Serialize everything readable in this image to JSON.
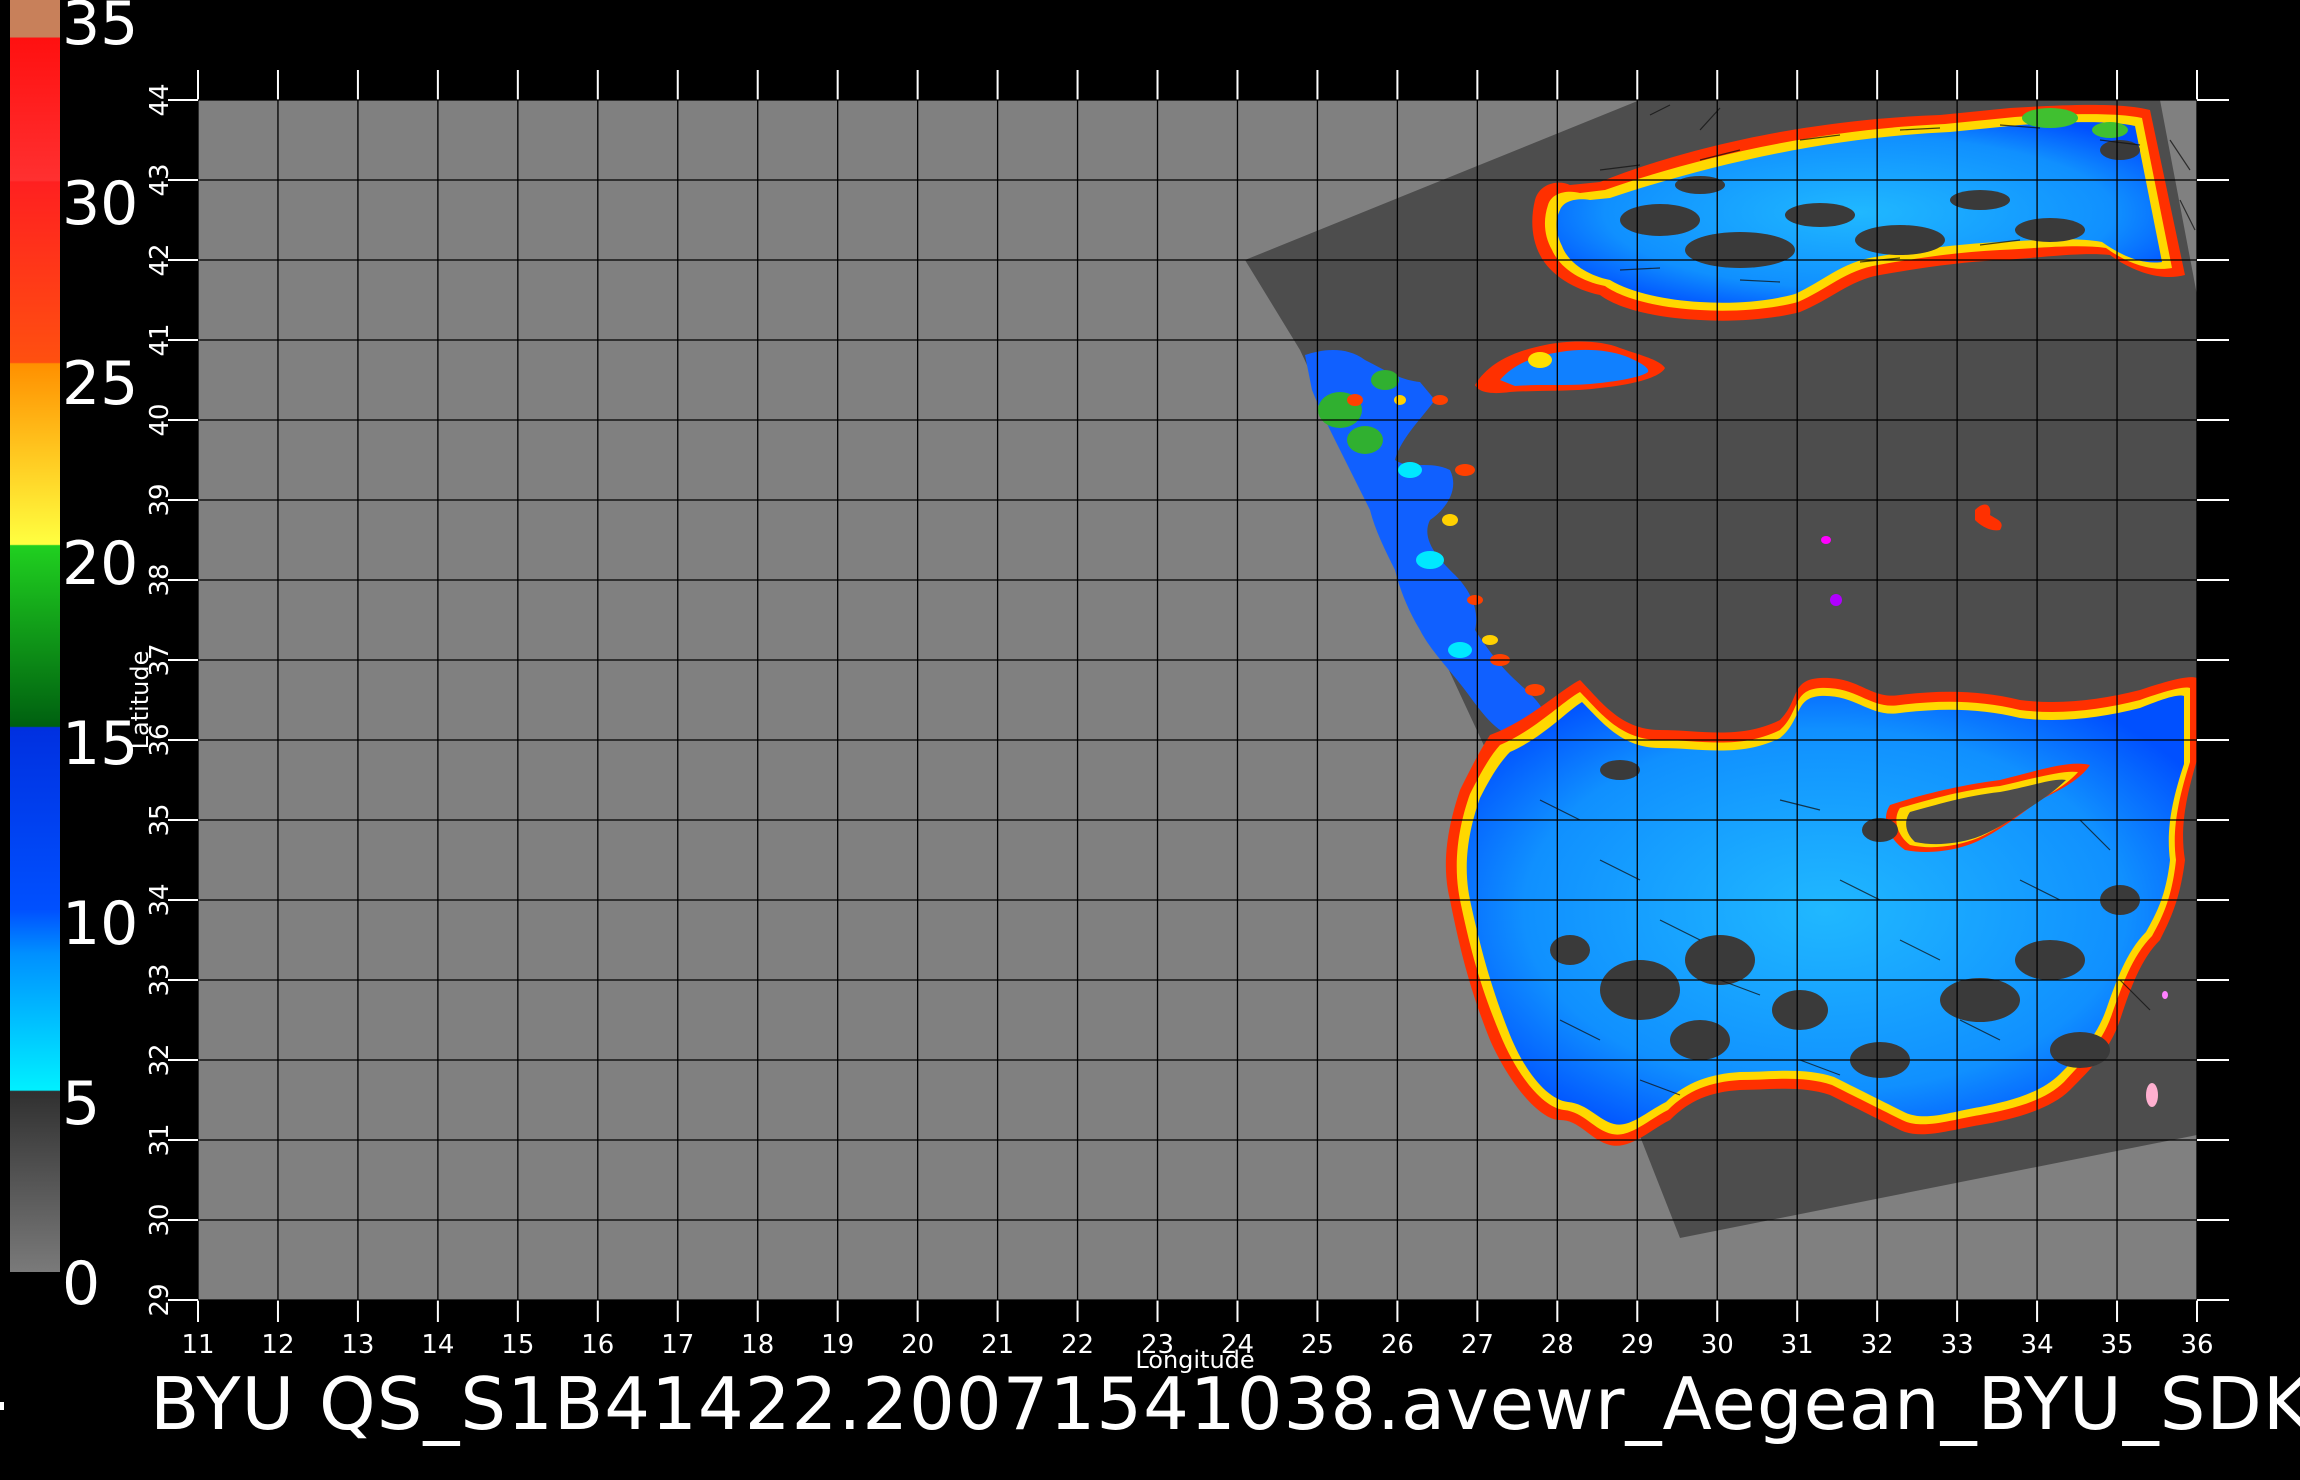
{
  "footer": {
    "title": "BYU  QS_S1B41422.20071541038.avewr_Aegean_BYU_SDK"
  },
  "map": {
    "xlabel": "Longitude",
    "ylabel": "Latitude",
    "lon_range": [
      11,
      36
    ],
    "lat_range": [
      29,
      44
    ],
    "lon_ticks": [
      "11",
      "12",
      "13",
      "14",
      "15",
      "16",
      "17",
      "18",
      "19",
      "20",
      "21",
      "22",
      "23",
      "24",
      "25",
      "26",
      "27",
      "28",
      "29",
      "30",
      "31",
      "32",
      "33",
      "34",
      "35",
      "36"
    ],
    "lat_ticks": [
      "29",
      "30",
      "31",
      "32",
      "33",
      "34",
      "35",
      "36",
      "37",
      "38",
      "39",
      "40",
      "41",
      "42",
      "43",
      "44"
    ]
  },
  "colorbar": {
    "labels": [
      "35",
      "30",
      "25",
      "20",
      "15",
      "10",
      "5",
      "0"
    ],
    "colors": [
      "#c8805a",
      "#ff2020",
      "#ff7010",
      "#ffd800",
      "#10a010",
      "#1050ff",
      "#00e8ff",
      "#505050"
    ]
  },
  "colors": {
    "background": "#000000",
    "land_gray": "#808080",
    "swath_gray": "#4d4d4d",
    "grid": "#000000"
  }
}
